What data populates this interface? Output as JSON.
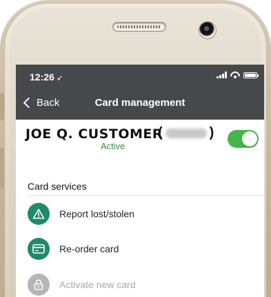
{
  "status_bar": {
    "time": "12:26",
    "location_glyph": "➶"
  },
  "nav": {
    "back_label": "Back",
    "title": "Card management"
  },
  "card": {
    "holder_name": "JOE Q. CUSTOMER",
    "number_open": "(",
    "number_close": ")",
    "status": "Active",
    "enabled": true
  },
  "services": {
    "title": "Card services",
    "items": [
      {
        "label": "Report lost/stolen",
        "icon": "warning-triangle-icon",
        "enabled": true
      },
      {
        "label": "Re-order card",
        "icon": "credit-card-icon",
        "enabled": true
      },
      {
        "label": "Activate new card",
        "icon": "lock-icon",
        "enabled": false
      }
    ]
  },
  "colors": {
    "header": "#46494b",
    "accent": "#1f8a6c",
    "toggle_on": "#45b64e",
    "active_text": "#3a8a3a",
    "disabled": "#b6b6b6"
  }
}
